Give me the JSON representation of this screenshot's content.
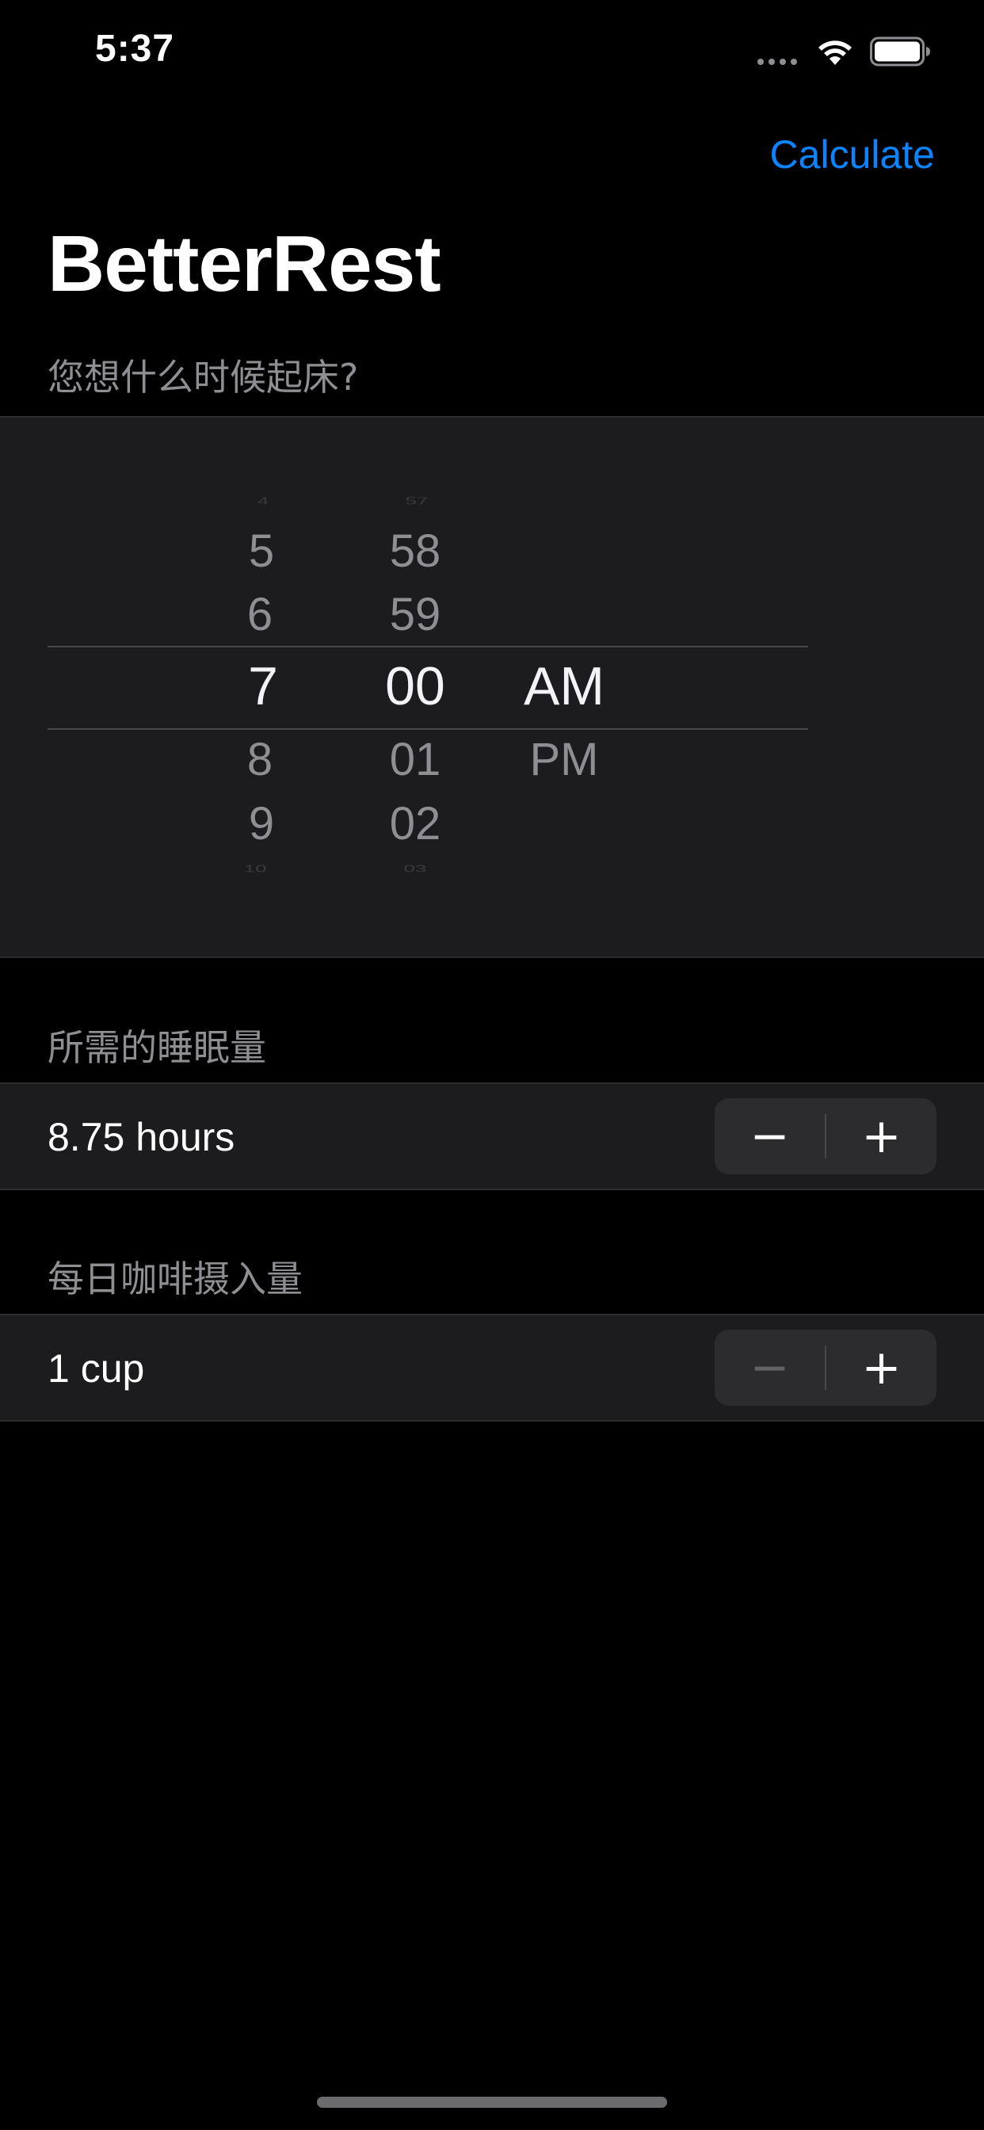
{
  "status_bar": {
    "time": "5:37"
  },
  "nav": {
    "calculate_label": "Calculate",
    "title": "BetterRest"
  },
  "wake_section": {
    "header": "您想什么时候起床?",
    "picker": {
      "hour": {
        "faint_above": "4",
        "above": [
          "5",
          "6"
        ],
        "selected": "7",
        "below": [
          "8",
          "9"
        ],
        "faint_below": "10"
      },
      "minute": {
        "faint_above": "57",
        "above": [
          "58",
          "59"
        ],
        "selected": "00",
        "below": [
          "01",
          "02"
        ],
        "faint_below": "03"
      },
      "period": {
        "selected": "AM",
        "below": [
          "PM"
        ]
      }
    }
  },
  "sleep_section": {
    "header": "所需的睡眠量",
    "value": "8.75 hours",
    "decrement": "−",
    "increment": "+"
  },
  "coffee_section": {
    "header": "每日咖啡摄入量",
    "value": "1 cup",
    "decrement": "−",
    "increment": "+"
  }
}
